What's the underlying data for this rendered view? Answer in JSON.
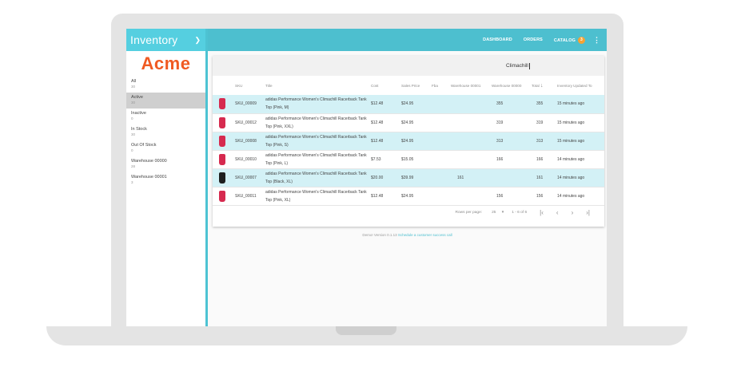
{
  "app": {
    "title": "Inventory",
    "logo_text": "Acme"
  },
  "sidebar": {
    "items": [
      {
        "label": "All",
        "count": "30"
      },
      {
        "label": "Active",
        "count": "30"
      },
      {
        "label": "Inactive",
        "count": "0"
      },
      {
        "label": "In Stock",
        "count": "30"
      },
      {
        "label": "Out Of Stock",
        "count": "0"
      },
      {
        "label": "Warehouse 00000",
        "count": "28"
      },
      {
        "label": "Warehouse 00001",
        "count": "3"
      }
    ]
  },
  "nav": {
    "dashboard": "DASHBOARD",
    "orders": "ORDERS",
    "catalog": "CATALOG",
    "catalog_badge": "3"
  },
  "search": {
    "value": "Climachill"
  },
  "table": {
    "columns": [
      "",
      "SKU",
      "Title",
      "Cost",
      "Sales Price",
      "Fba",
      "Warehouse 00001",
      "Warehouse 00000",
      "Total",
      "Inventory Updated To"
    ],
    "rows": [
      {
        "sku": "SKU_00009",
        "title": "adidas Performance Women's Climachill Racerback Tank Top (Pink, M)",
        "cost": "$12.48",
        "price": "$24.95",
        "fba": "",
        "wh1": "",
        "wh0": "355",
        "total": "355",
        "updated": "15 minutes ago",
        "color": "#d62a4f",
        "highlight": true
      },
      {
        "sku": "SKU_00012",
        "title": "adidas Performance Women's Climachill Racerback Tank Top (Pink, XXL)",
        "cost": "$12.48",
        "price": "$24.95",
        "fba": "",
        "wh1": "",
        "wh0": "319",
        "total": "319",
        "updated": "15 minutes ago",
        "color": "#d62a4f",
        "highlight": false
      },
      {
        "sku": "SKU_00008",
        "title": "adidas Performance Women's Climachill Racerback Tank Top (Pink, S)",
        "cost": "$12.48",
        "price": "$24.95",
        "fba": "",
        "wh1": "",
        "wh0": "313",
        "total": "313",
        "updated": "15 minutes ago",
        "color": "#d62a4f",
        "highlight": true
      },
      {
        "sku": "SKU_00010",
        "title": "adidas Performance Women's Climachill Racerback Tank Top (Pink, L)",
        "cost": "$7.53",
        "price": "$15.05",
        "fba": "",
        "wh1": "",
        "wh0": "166",
        "total": "166",
        "updated": "14 minutes ago",
        "color": "#d62a4f",
        "highlight": false
      },
      {
        "sku": "SKU_00007",
        "title": "adidas Performance Women's Climachill Racerback Tank Top (Black, XL)",
        "cost": "$20.00",
        "price": "$39.99",
        "fba": "",
        "wh1": "161",
        "wh0": "",
        "total": "161",
        "updated": "14 minutes ago",
        "color": "#1f1f1f",
        "highlight": true
      },
      {
        "sku": "SKU_00011",
        "title": "adidas Performance Women's Climachill Racerback Tank Top (Pink, XL)",
        "cost": "$12.48",
        "price": "$24.95",
        "fba": "",
        "wh1": "",
        "wh0": "156",
        "total": "156",
        "updated": "14 minutes ago",
        "color": "#d62a4f",
        "highlight": false
      }
    ]
  },
  "pagination": {
    "rows_per_page_label": "Rows per page:",
    "rows_per_page": "25",
    "range": "1 - 6 of 6"
  },
  "footer": {
    "version": "Demo! Version 0.1.13",
    "link": "Schedule a customer success call"
  },
  "colors": {
    "accent": "#4dbfcf",
    "sidebar_header": "#55cfe0",
    "brand": "#f05a22",
    "highlight_row": "#d3f1f6",
    "badge": "#f7a233"
  },
  "icons": [
    "chevron-down-icon",
    "more-vert-icon",
    "arrow-down-icon",
    "first-page-icon",
    "prev-page-icon",
    "next-page-icon",
    "last-page-icon",
    "dropdown-icon"
  ]
}
